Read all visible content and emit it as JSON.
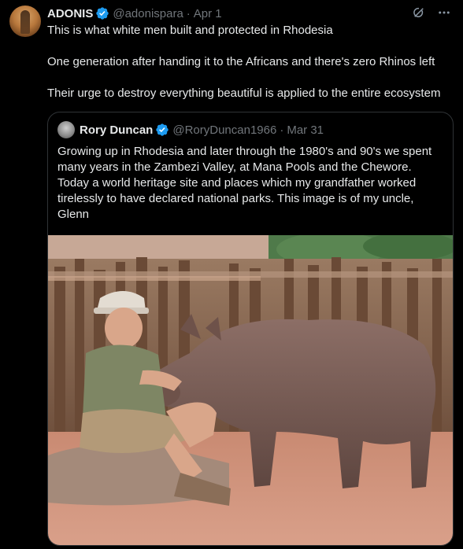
{
  "post": {
    "author": {
      "display_name": "ADONIS",
      "handle": "@adonispara",
      "date": "Apr 1"
    },
    "text_lines": [
      "This is what white men built and protected in Rhodesia",
      "One generation after handing it to the Africans and there's zero Rhinos left",
      "Their urge to destroy everything beautiful is applied to the entire ecosystem"
    ],
    "icons": {
      "verified": "verified-badge-icon",
      "grok": "grok-icon",
      "more": "more-icon"
    },
    "accent_color": "#1d9bf0"
  },
  "quoted_post": {
    "author": {
      "display_name": "Rory Duncan",
      "handle": "@RoryDuncan1966",
      "date": "Mar 31"
    },
    "text": "Growing up in Rhodesia and later through the 1980's and 90's we spent many years in the Zambezi Valley, at Mana Pools and the Chewore. Today a world heritage site and places which my grandfather worked tirelessly to have declared national parks. This image is of my uncle, Glenn",
    "media": {
      "description_icon": "photo-man-with-baby-rhino"
    }
  }
}
